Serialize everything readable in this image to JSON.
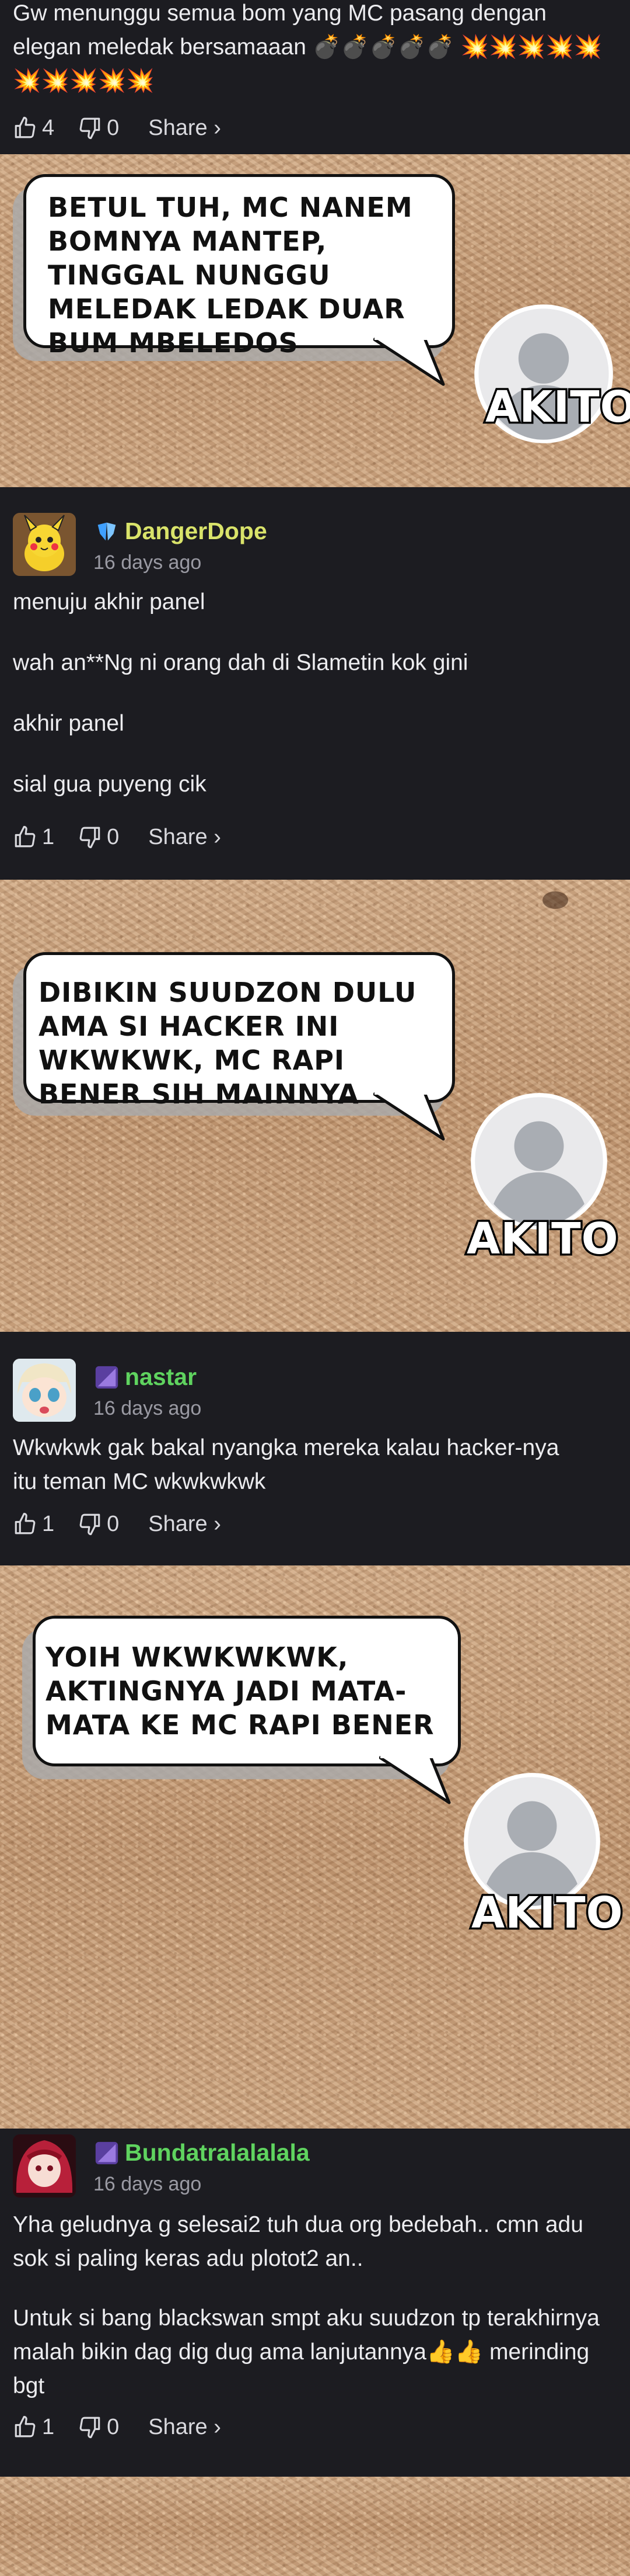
{
  "comment0": {
    "text": "Gw menunggu semua bom yang MC pasang dengan elegan meledak bersamaaan 💣💣💣💣💣 💥💥💥💥💥💥💥💥💥💥",
    "likes": "4",
    "dislikes": "0",
    "share": "Share ›"
  },
  "panel1": {
    "bubble": "BETUL TUH, MC NANEM BOMNYA MANTEP, TINGGAL NUNGGU MELEDAK LEDAK DUAR BUM MBELEDOS",
    "name": "AKITO"
  },
  "comment1": {
    "username": "DangerDope",
    "time": "16 days ago",
    "lines": [
      "menuju akhir panel",
      "wah an**Ng ni orang dah di Slametin kok gini",
      "akhir panel",
      "sial gua puyeng cik"
    ],
    "likes": "1",
    "dislikes": "0",
    "share": "Share ›",
    "name_color": "#d9e36a"
  },
  "panel2": {
    "bubble": "DIBIKIN SUUDZON DULU AMA SI HACKER INI WKWKWK, MC RAPI BENER SIH MAINNYA",
    "name": "AKITO"
  },
  "comment2": {
    "username": "nastar",
    "time": "16 days ago",
    "text": "Wkwkwk gak bakal nyangka mereka kalau hacker-nya itu teman MC wkwkwkwk",
    "likes": "1",
    "dislikes": "0",
    "share": "Share ›",
    "name_color": "#5fd35f"
  },
  "panel3": {
    "bubble": "YOIH WKWKWKWK, AKTINGNYA JADI MATA-MATA KE MC RAPI BENER",
    "name": "AKITO"
  },
  "comment3": {
    "username": "Bundatralalalala",
    "time": "16 days ago",
    "para1": "Yha geludnya g selesai2 tuh dua org bedebah.. cmn adu sok si paling keras adu plotot2 an..",
    "para2": "Untuk si bang blackswan smpt aku suudzon tp terakhirnya malah bikin dag dig dug ama lanjutannya👍👍 merinding bgt",
    "likes": "1",
    "dislikes": "0",
    "share": "Share ›",
    "name_color": "#5fd35f"
  }
}
